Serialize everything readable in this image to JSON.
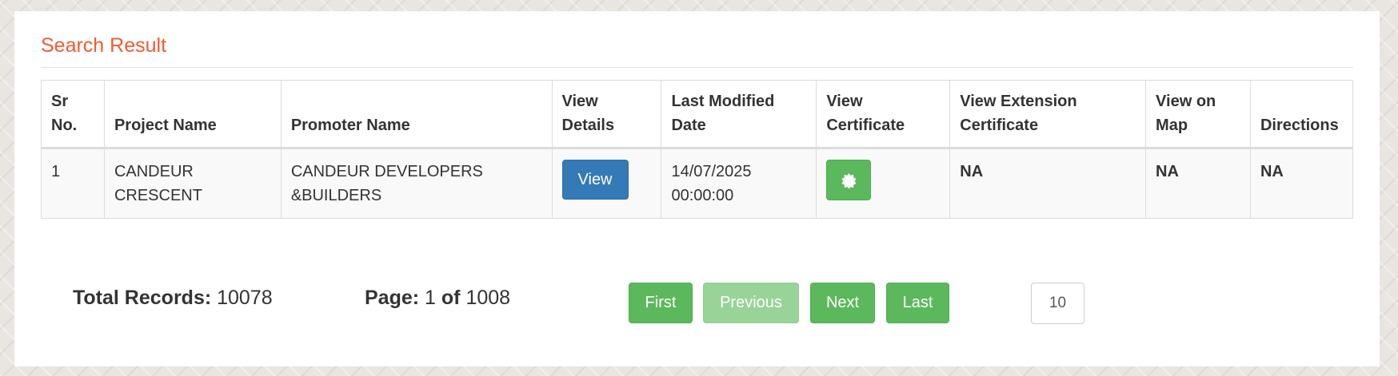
{
  "search": {
    "title": "Search Result",
    "columns": [
      [
        "Sr",
        "No."
      ],
      [
        "Project Name"
      ],
      [
        "Promoter Name"
      ],
      [
        "View",
        "Details"
      ],
      [
        "Last Modified",
        "Date"
      ],
      [
        "View",
        "Certificate"
      ],
      [
        "View Extension",
        "Certificate"
      ],
      [
        "View on",
        "Map"
      ],
      [
        "Directions"
      ]
    ],
    "rows": [
      {
        "sr_no": "1",
        "project_name": [
          "CANDEUR",
          "CRESCENT"
        ],
        "promoter_name": [
          "CANDEUR DEVELOPERS",
          "&BUILDERS"
        ],
        "view_label": "View",
        "last_modified": [
          "14/07/2025",
          "00:00:00"
        ],
        "certificate_icon": "certificate-seal-icon",
        "extension_certificate": "NA",
        "view_on_map": "NA",
        "directions": "NA"
      }
    ]
  },
  "pagination": {
    "total_label": "Total Records:",
    "total_value": "10078",
    "page_label": "Page:",
    "page_current": "1",
    "page_of": "of",
    "page_total": "1008",
    "first_label": "First",
    "previous_label": "Previous",
    "next_label": "Next",
    "last_label": "Last",
    "page_size": "10"
  },
  "colors": {
    "title": "#ef5b34",
    "view_button": "#337ab7",
    "green_button": "#5cb85c",
    "disabled_button": "#98d398"
  }
}
